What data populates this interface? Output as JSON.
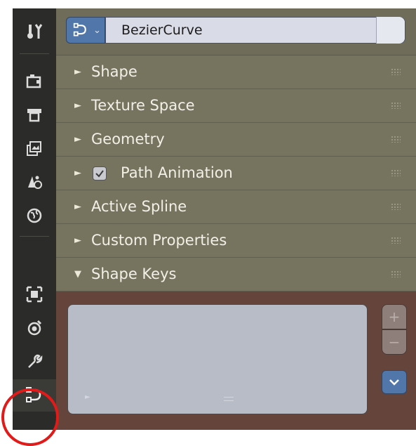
{
  "object_data": {
    "name": "BezierCurve",
    "type_icon": "curve-data-icon"
  },
  "sections": [
    {
      "label": "Shape",
      "expanded": false
    },
    {
      "label": "Texture Space",
      "expanded": false
    },
    {
      "label": "Geometry",
      "expanded": false
    },
    {
      "label": "Path Animation",
      "expanded": false,
      "checkbox": true,
      "checked": true
    },
    {
      "label": "Active Spline",
      "expanded": false
    },
    {
      "label": "Custom Properties",
      "expanded": false
    },
    {
      "label": "Shape Keys",
      "expanded": true
    }
  ],
  "tabs": [
    {
      "name": "tool-icon"
    },
    {
      "name": "render-icon"
    },
    {
      "name": "output-icon"
    },
    {
      "name": "view-layer-icon"
    },
    {
      "name": "scene-icon"
    },
    {
      "name": "world-icon"
    },
    {
      "name": "object-icon"
    },
    {
      "name": "physics-icon"
    },
    {
      "name": "modifier-icon"
    },
    {
      "name": "curve-data-icon",
      "active": true
    }
  ],
  "shape_keys": {
    "add_label": "+",
    "remove_label": "−"
  },
  "colors": {
    "panel_bg": "#6f6c5a",
    "section_bg": "#76735f",
    "tabbar_bg": "#2b2b29",
    "accent_blue": "#5176a9",
    "shape_keys_bg": "#65443c",
    "highlight_red": "#e11a1a"
  }
}
